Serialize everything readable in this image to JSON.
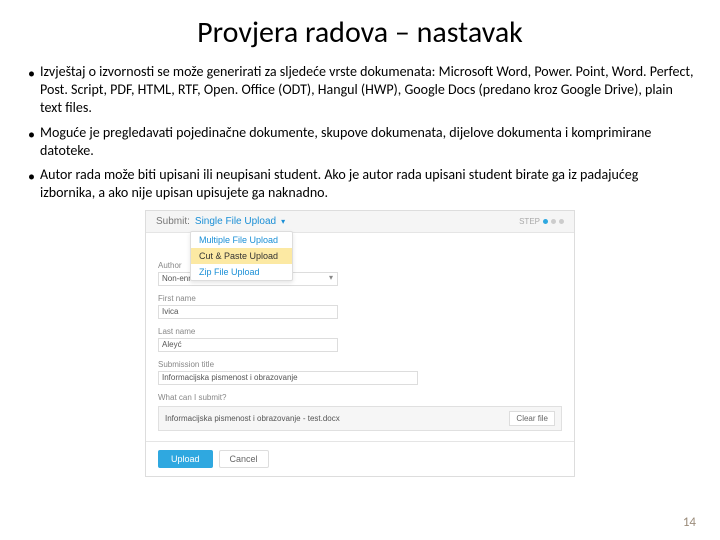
{
  "title": "Provjera radova – nastavak",
  "bullets": [
    "Izvještaj o izvornosti se može generirati za sljedeće vrste dokumenata: Microsoft Word, Power. Point, Word. Perfect, Post. Script, PDF, HTML, RTF, Open. Office (ODT), Hangul (HWP), Google Docs (predano kroz Google Drive), plain text files.",
    "Moguće je pregledavati pojedinačne dokumente, skupove dokumenata, dijelove dokumenta i komprimirane datoteke.",
    "Autor rada može biti upisani ili neupisani student. Ako je autor rada upisani student birate ga iz padajućeg izbornika, a ako nije upisan upisujete ga naknadno."
  ],
  "screenshot": {
    "submit_label": "Submit:",
    "upload_type": "Single File Upload",
    "step_label": "STEP",
    "dropdown": {
      "opt1": "Multiple File Upload",
      "opt2": "Cut & Paste Upload",
      "opt3": "Zip File Upload"
    },
    "fields": {
      "author_label": "Author",
      "author_value": "Non-enrolled student",
      "firstname_label": "First name",
      "firstname_value": "Ivica",
      "lastname_label": "Last name",
      "lastname_value": "Aleyć",
      "title_label": "Submission title",
      "title_value": "Informacijska pismenost i obrazovanje"
    },
    "what_submit": "What can I submit?",
    "file_name": "Informacijska pismenost i obrazovanje - test.docx",
    "clear_label": "Clear file",
    "upload_btn": "Upload",
    "cancel_btn": "Cancel"
  },
  "page_number": "14"
}
